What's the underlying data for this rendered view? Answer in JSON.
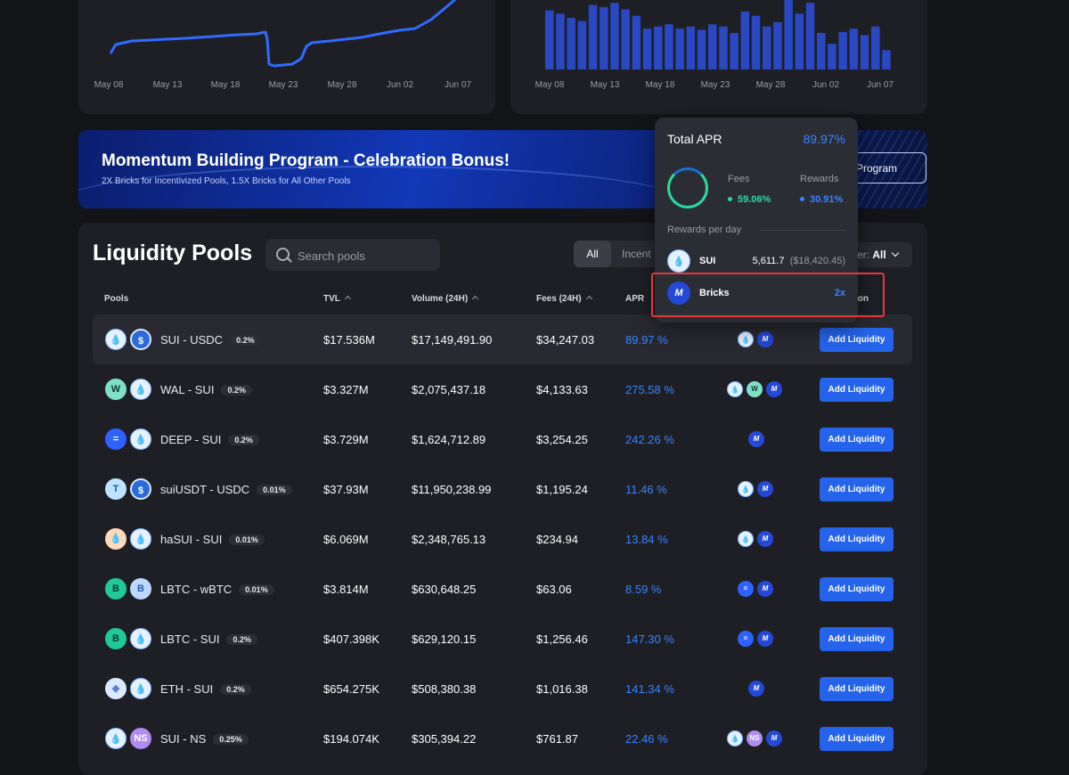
{
  "chart_data": [
    {
      "type": "line",
      "x": [
        "May 08",
        "May 13",
        "May 18",
        "May 23",
        "May 28",
        "Jun 02",
        "Jun 07"
      ],
      "title": "",
      "xlabel": "",
      "ylabel": "",
      "color": "#2f6bff",
      "grid": false
    },
    {
      "type": "bar",
      "x": [
        "May 08",
        "May 13",
        "May 18",
        "May 23",
        "May 28",
        "Jun 02",
        "Jun 07"
      ],
      "values": [
        55,
        52,
        48,
        45,
        60,
        58,
        62,
        56,
        50,
        38,
        40,
        42,
        38,
        40,
        37,
        42,
        40,
        34,
        54,
        50,
        40,
        44,
        65,
        52,
        62,
        34,
        24,
        35,
        38,
        32,
        40,
        18
      ],
      "title": "",
      "xlabel": "",
      "ylabel": "",
      "color": "#2a48c2",
      "grid": false
    }
  ],
  "banner": {
    "title": "Momentum Building Program - Celebration Bonus!",
    "subtitle": "2X Bricks for Incentivized Pools, 1.5X Bricks for All Other Pools",
    "button": "Program"
  },
  "pools": {
    "title": "Liquidity Pools",
    "search_placeholder": "Search pools",
    "tabs": {
      "all": "All",
      "incentivized": "Incent"
    },
    "filter": {
      "label": "er:",
      "value": "All"
    },
    "headers": {
      "pools": "Pools",
      "tvl": "TVL",
      "volume": "Volume (24H)",
      "fees": "Fees (24H)",
      "apr": "APR",
      "action": "ion"
    },
    "add_label": "Add Liquidity",
    "rows": [
      {
        "name": "SUI - USDC",
        "fee": "0.2%",
        "tvl": "$17.536M",
        "volume": "$17,149,491.90",
        "fees": "$34,247.03",
        "apr": "89.97 %"
      },
      {
        "name": "WAL - SUI",
        "fee": "0.2%",
        "tvl": "$3.327M",
        "volume": "$2,075,437.18",
        "fees": "$4,133.63",
        "apr": "275.58 %"
      },
      {
        "name": "DEEP - SUI",
        "fee": "0.2%",
        "tvl": "$3.729M",
        "volume": "$1,624,712.89",
        "fees": "$3,254.25",
        "apr": "242.26 %"
      },
      {
        "name": "suiUSDT - USDC",
        "fee": "0.01%",
        "tvl": "$37.93M",
        "volume": "$11,950,238.99",
        "fees": "$1,195.24",
        "apr": "11.46 %"
      },
      {
        "name": "haSUI - SUI",
        "fee": "0.01%",
        "tvl": "$6.069M",
        "volume": "$2,348,765.13",
        "fees": "$234.94",
        "apr": "13.84 %"
      },
      {
        "name": "LBTC - wBTC",
        "fee": "0.01%",
        "tvl": "$3.814M",
        "volume": "$630,648.25",
        "fees": "$63.06",
        "apr": "8.59 %"
      },
      {
        "name": "LBTC - SUI",
        "fee": "0.2%",
        "tvl": "$407.398K",
        "volume": "$629,120.15",
        "fees": "$1,256.46",
        "apr": "147.30 %"
      },
      {
        "name": "ETH - SUI",
        "fee": "0.2%",
        "tvl": "$654.275K",
        "volume": "$508,380.38",
        "fees": "$1,016.38",
        "apr": "141.34 %"
      },
      {
        "name": "SUI - NS",
        "fee": "0.25%",
        "tvl": "$194.074K",
        "volume": "$305,394.22",
        "fees": "$761.87",
        "apr": "22.46 %"
      }
    ]
  },
  "tooltip": {
    "title": "Total APR",
    "total": "89.97%",
    "fees_label": "Fees",
    "fees_val": "59.06%",
    "rewards_label": "Rewards",
    "rewards_val": "30.91%",
    "rpd_label": "Rewards per day",
    "sui_name": "SUI",
    "sui_amount": "5,611.7",
    "sui_usd": "($18,420.45)",
    "bricks_name": "Bricks",
    "bricks_mult": "2x"
  },
  "colors": {
    "accent": "#2563eb",
    "apr": "#3b82ff",
    "fees_green": "#2bd9a0",
    "highlight": "#e53935"
  }
}
